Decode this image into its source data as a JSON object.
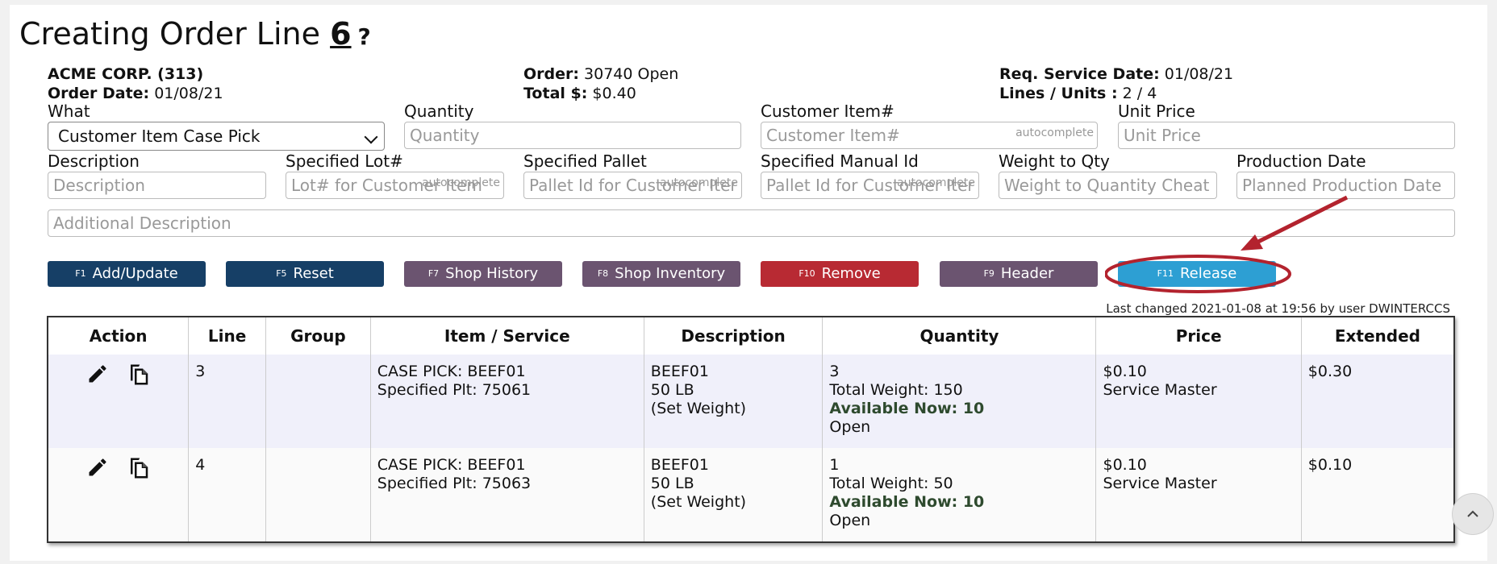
{
  "header": {
    "title_prefix": "Creating Order Line",
    "line_number": "6",
    "help": "?"
  },
  "info": {
    "customer": "ACME CORP. (313)",
    "order_date_label": "Order Date:",
    "order_date": "01/08/21",
    "order_label": "Order:",
    "order": "30740 Open",
    "total_label": "Total $:",
    "total": "$0.40",
    "req_date_label": "Req. Service Date:",
    "req_date": "01/08/21",
    "lines_label": "Lines / Units :",
    "lines_units": "2 / 4"
  },
  "form": {
    "what_label": "What",
    "what_value": "Customer Item Case Pick",
    "quantity_label": "Quantity",
    "quantity_placeholder": "Quantity",
    "customer_item_label": "Customer Item#",
    "customer_item_placeholder": "Customer Item#",
    "autocomplete": "autocomplete",
    "unit_price_label": "Unit Price",
    "unit_price_placeholder": "Unit Price",
    "description_label": "Description",
    "description_placeholder": "Description",
    "lot_label": "Specified Lot#",
    "lot_placeholder": "Lot# for Customer Item",
    "pallet_label": "Specified Pallet",
    "pallet_placeholder": "Pallet Id for Customer Iter",
    "manual_label": "Specified Manual Id",
    "manual_placeholder": "Pallet Id for Customer Iter",
    "weight_label": "Weight to Qty",
    "weight_placeholder": "Weight to Quantity Cheat",
    "production_label": "Production Date",
    "production_placeholder": "Planned Production Date",
    "additional_placeholder": "Additional Description"
  },
  "buttons": [
    {
      "key": "F1",
      "label": "Add/Update",
      "color": "#163f66"
    },
    {
      "key": "F5",
      "label": "Reset",
      "color": "#163f66"
    },
    {
      "key": "F7",
      "label": "Shop History",
      "color": "#6b5470"
    },
    {
      "key": "F8",
      "label": "Shop Inventory",
      "color": "#6b5470"
    },
    {
      "key": "F10",
      "label": "Remove",
      "color": "#b82a33"
    },
    {
      "key": "F9",
      "label": "Header",
      "color": "#6b5470"
    },
    {
      "key": "F11",
      "label": "Release",
      "color": "#2d9fd3"
    }
  ],
  "last_changed": "Last changed 2021-01-08 at 19:56 by user DWINTERCCS",
  "table": {
    "columns": [
      "Action",
      "Line",
      "Group",
      "Item / Service",
      "Description",
      "Quantity",
      "Price",
      "Extended"
    ],
    "rows": [
      {
        "line": "3",
        "group": "",
        "item1": "CASE PICK: BEEF01",
        "item2": "Specified Plt: 75061",
        "desc1": "BEEF01",
        "desc2": "50 LB",
        "desc3": "(Set Weight)",
        "qty": "3",
        "weight": "Total Weight: 150",
        "avail": "Available Now: 10",
        "status": "Open",
        "price": "$0.10",
        "price_src": "Service Master",
        "extended": "$0.30",
        "edit_icon": "pencil-icon",
        "copy_icon": "copy-icon"
      },
      {
        "line": "4",
        "group": "",
        "item1": "CASE PICK: BEEF01",
        "item2": "Specified Plt: 75063",
        "desc1": "BEEF01",
        "desc2": "50 LB",
        "desc3": "(Set Weight)",
        "qty": "1",
        "weight": "Total Weight: 50",
        "avail": "Available Now: 10",
        "status": "Open",
        "price": "$0.10",
        "price_src": "Service Master",
        "extended": "$0.10",
        "edit_icon": "pencil-icon",
        "copy_icon": "copy-icon"
      }
    ]
  },
  "annotation_color": "#b3232e",
  "scroll_icon": "chevron-up-icon"
}
